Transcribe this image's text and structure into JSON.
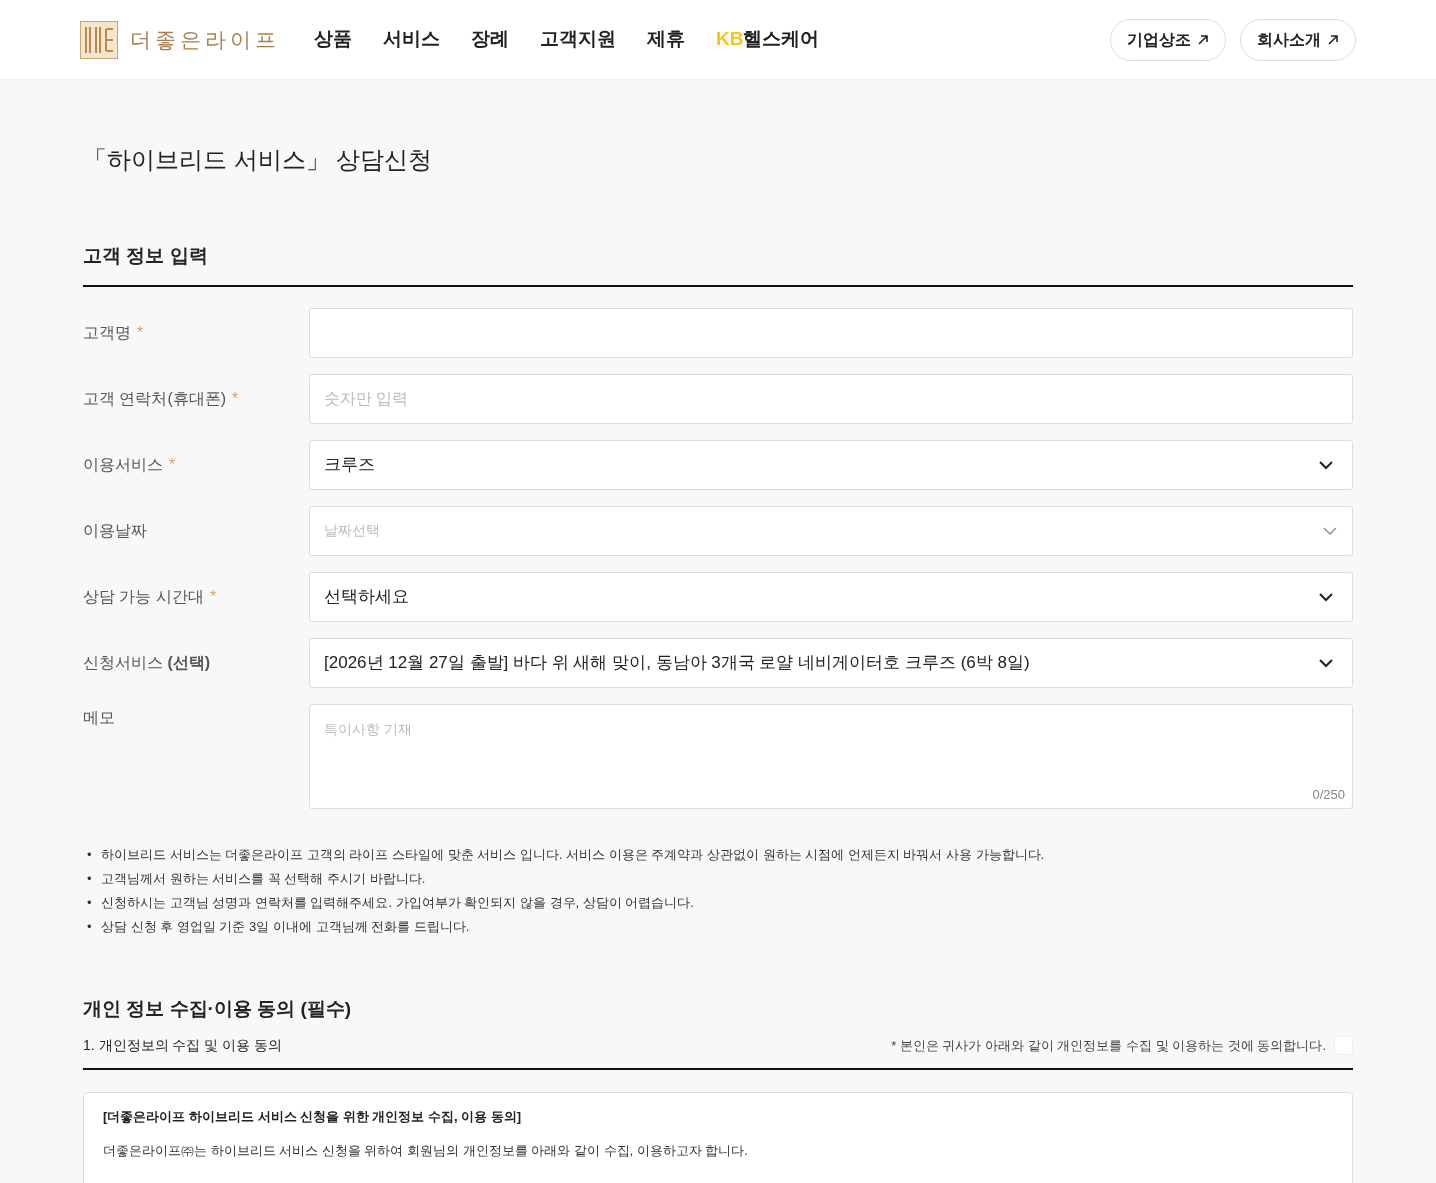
{
  "header": {
    "logo_text": "더좋은라이프",
    "nav": [
      {
        "label": "상품"
      },
      {
        "label": "서비스"
      },
      {
        "label": "장례"
      },
      {
        "label": "고객지원"
      },
      {
        "label": "제휴"
      },
      {
        "prefix": "KB",
        "label": "헬스케어"
      }
    ],
    "buttons": [
      "기업상조",
      "회사소개"
    ]
  },
  "page_title": "「하이브리드 서비스」 상담신청",
  "form": {
    "heading": "고객 정보 입력",
    "fields": [
      {
        "kind": "text",
        "label": "고객명",
        "required_mark": "*"
      },
      {
        "kind": "text",
        "label": "고객 연락처(휴대폰)",
        "required_mark": "*",
        "placeholder": "숫자만 입력"
      },
      {
        "kind": "select",
        "label": "이용서비스",
        "required_mark": "*",
        "value": "크루즈"
      },
      {
        "kind": "date",
        "label": "이용날짜",
        "placeholder": "날짜선택"
      },
      {
        "kind": "select",
        "label": "상담 가능 시간대",
        "required_mark": "*",
        "value": "선택하세요"
      },
      {
        "kind": "select",
        "label": "신청서비스 **(선택)**",
        "value": "[2026년 12월 27일 출발] 바다 위 새해 맞이, 동남아 3개국 로얄 네비게이터호 크루즈 (6박 8일)"
      },
      {
        "kind": "textarea",
        "label": "메모",
        "placeholder": "특이사항 기재",
        "counter": "0/250"
      }
    ]
  },
  "notes": [
    {
      "marker": "•",
      "text": "하이브리드 서비스는 더좋은라이프 고객의 라이프 스타일에 맞춘 서비스 입니다. 서비스 이용은 주계약과 상관없이 원하는 시점에 언제든지 바꿔서 사용 가능합니다."
    },
    {
      "marker": "•",
      "text": "고객님께서 원하는 서비스를 꼭 선택해 주시기 바랍니다."
    },
    {
      "marker": "•",
      "text": "신청하시는 고객님 성명과 연락처를 입력해주세요. 가입여부가 확인되지 않을 경우, 상담이 어렵습니다."
    },
    {
      "marker": "•",
      "text": "상담 신청 후 영업일 기준 3일 이내에 고객님께 전화를 드립니다."
    }
  ],
  "consent": {
    "heading": "개인 정보 수집·이용 동의 (필수)",
    "item_title": "1. 개인정보의 수집 및 이용 동의",
    "agree_text": "* 본인은 귀사가 아래와 같이 개인정보를 수집 및 이용하는 것에 동의합니다.",
    "checked": false,
    "box_title": "[더좋은라이프 하이브리드 서비스 신청을 위한 개인정보 수집, 이용 동의]",
    "box_text": "더좋은라이프㈜는 하이브리드 서비스 신청을 위하여 회원님의 개인정보를 아래와 같이 수집, 이용하고자 합니다."
  }
}
